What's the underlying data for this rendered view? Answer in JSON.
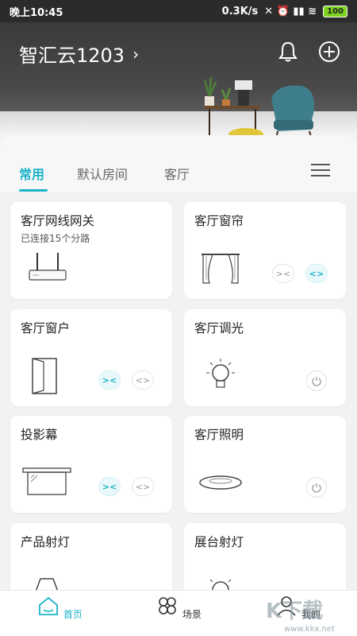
{
  "status_bar": {
    "time": "晚上10:45",
    "speed": "0.3K/s",
    "battery": "100"
  },
  "header": {
    "home_name": "智汇云1203",
    "chevron": "›"
  },
  "tabs": [
    {
      "label": "常用",
      "active": true
    },
    {
      "label": "默认房间",
      "active": false
    },
    {
      "label": "客厅",
      "active": false
    }
  ],
  "cards": [
    {
      "title": "客厅网线网关",
      "subtitle": "已连接15个分路",
      "device_icon": "router-icon"
    },
    {
      "title": "客厅窗帘",
      "device_icon": "curtain-icon",
      "controls": [
        "><",
        "<>"
      ]
    },
    {
      "title": "客厅窗户",
      "device_icon": "window-icon",
      "controls": [
        "><",
        "<>"
      ]
    },
    {
      "title": "客厅调光",
      "device_icon": "bulb-icon"
    },
    {
      "title": "投影幕",
      "device_icon": "projector-screen-icon",
      "controls": [
        "><",
        "<>"
      ]
    },
    {
      "title": "客厅照明",
      "device_icon": "ceiling-light-icon"
    },
    {
      "title": "产品射灯",
      "device_icon": "spotlight-icon"
    },
    {
      "title": "展台射灯",
      "device_icon": "bulb-icon"
    }
  ],
  "bottom_nav": [
    {
      "label": "首页",
      "icon": "home-icon",
      "active": true
    },
    {
      "label": "场景",
      "icon": "scene-icon",
      "active": false
    },
    {
      "label": "我的",
      "icon": "profile-icon",
      "active": false
    }
  ],
  "watermark": {
    "text": "K下载",
    "url": "www.kkx.net"
  },
  "colors": {
    "accent": "#1ab3c8",
    "background": "#f2f2f2",
    "card": "#ffffff"
  }
}
